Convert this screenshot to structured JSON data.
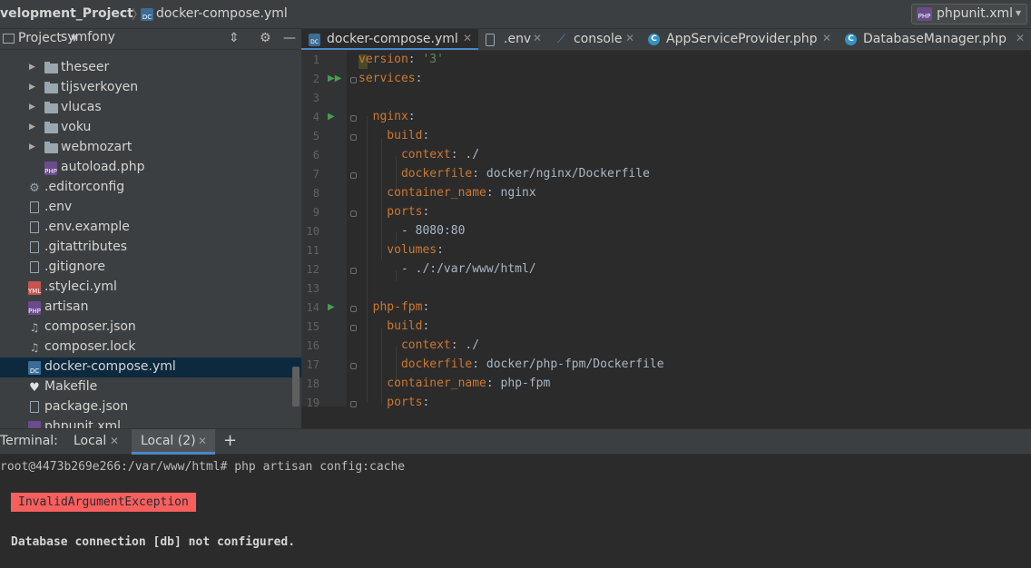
{
  "navbar": {
    "project_crumb": "velopment_Project",
    "file_crumb": "docker-compose.yml",
    "file_icon": "DC",
    "run_config": "phpunit.xml",
    "run_config_icon": "PHP"
  },
  "project_panel": {
    "title": "Project",
    "header_icons": [
      "collapse-icon",
      "gear-icon",
      "minimize-icon"
    ],
    "partial_top": "symfony",
    "items": [
      {
        "label": "theseer",
        "type": "folder"
      },
      {
        "label": "tijsverkoyen",
        "type": "folder"
      },
      {
        "label": "vlucas",
        "type": "folder"
      },
      {
        "label": "voku",
        "type": "folder"
      },
      {
        "label": "webmozart",
        "type": "folder"
      },
      {
        "label": "autoload.php",
        "type": "php"
      },
      {
        "label": ".editorconfig",
        "type": "config"
      },
      {
        "label": ".env",
        "type": "text"
      },
      {
        "label": ".env.example",
        "type": "text"
      },
      {
        "label": ".gitattributes",
        "type": "text"
      },
      {
        "label": ".gitignore",
        "type": "text"
      },
      {
        "label": ".styleci.yml",
        "type": "yml"
      },
      {
        "label": "artisan",
        "type": "php"
      },
      {
        "label": "composer.json",
        "type": "composer"
      },
      {
        "label": "composer.lock",
        "type": "composer"
      },
      {
        "label": "docker-compose.yml",
        "type": "docker",
        "selected": true
      },
      {
        "label": "Makefile",
        "type": "make"
      },
      {
        "label": "package.json",
        "type": "json"
      },
      {
        "label": "phpunit.xml",
        "type": "php"
      }
    ]
  },
  "editor": {
    "tabs": [
      {
        "label": "docker-compose.yml",
        "icon": "DC",
        "active": true,
        "closable": true
      },
      {
        "label": ".env",
        "icon": "text",
        "closable": true
      },
      {
        "label": "console",
        "icon": "console",
        "closable": true
      },
      {
        "label": "AppServiceProvider.php",
        "icon": "C",
        "closable": true
      },
      {
        "label": "DatabaseManager.php",
        "icon": "C",
        "closable": true
      }
    ],
    "lines": [
      {
        "n": "1",
        "text": "version: '3'"
      },
      {
        "n": "2",
        "text": "services:"
      },
      {
        "n": "3",
        "text": ""
      },
      {
        "n": "4",
        "text": "  nginx:"
      },
      {
        "n": "5",
        "text": "    build:"
      },
      {
        "n": "6",
        "text": "      context: ./"
      },
      {
        "n": "7",
        "text": "      dockerfile: docker/nginx/Dockerfile"
      },
      {
        "n": "8",
        "text": "    container_name: nginx"
      },
      {
        "n": "9",
        "text": "    ports:"
      },
      {
        "n": "10",
        "text": "      - 8080:80"
      },
      {
        "n": "11",
        "text": "    volumes:"
      },
      {
        "n": "12",
        "text": "      - ./:/var/www/html/"
      },
      {
        "n": "13",
        "text": ""
      },
      {
        "n": "14",
        "text": "  php-fpm:"
      },
      {
        "n": "15",
        "text": "    build:"
      },
      {
        "n": "16",
        "text": "      context: ./"
      },
      {
        "n": "17",
        "text": "      dockerfile: docker/php-fpm/Dockerfile"
      },
      {
        "n": "18",
        "text": "    container_name: php-fpm"
      },
      {
        "n": "19",
        "text": "    ports:"
      }
    ]
  },
  "terminal": {
    "label": "Terminal:",
    "tabs": [
      {
        "label": "Local",
        "active": false
      },
      {
        "label": "Local (2)",
        "active": true
      }
    ],
    "add_label": "+",
    "command_line": "root@4473b269e266:/var/www/html# php artisan config:cache",
    "exception": "InvalidArgumentException",
    "message": "Database connection [db] not configured."
  },
  "colors": {
    "keyword": "#cc7832",
    "string": "#6a8759",
    "selection": "#0d293e",
    "exception_bg": "#f75f5f",
    "accent": "#4a88c7"
  }
}
